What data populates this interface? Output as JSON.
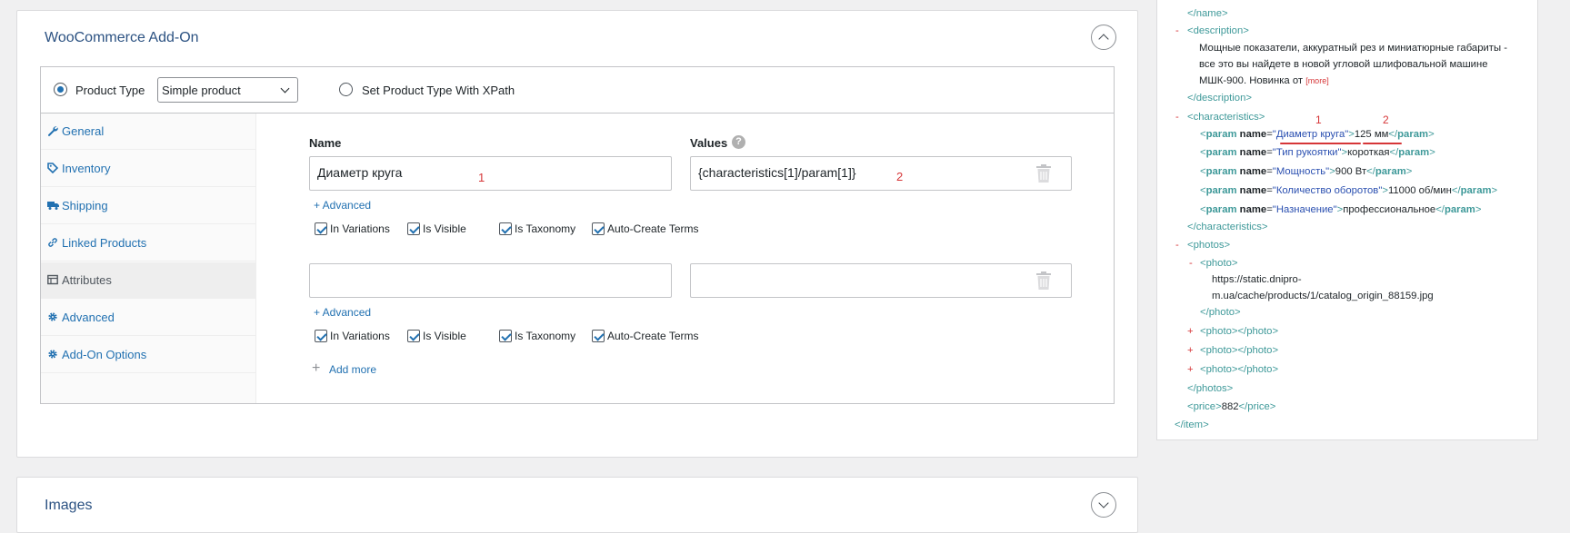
{
  "addon": {
    "title": "WooCommerce Add-On",
    "product_type_label": "Product Type",
    "product_type_value": "Simple product",
    "xpath_label": "Set Product Type With XPath"
  },
  "tabs": [
    {
      "label": "General",
      "icon": "wrench-icon"
    },
    {
      "label": "Inventory",
      "icon": "tag-icon"
    },
    {
      "label": "Shipping",
      "icon": "truck-icon"
    },
    {
      "label": "Linked Products",
      "icon": "link-icon"
    },
    {
      "label": "Attributes",
      "icon": "table-icon"
    },
    {
      "label": "Advanced",
      "icon": "gear-icon"
    },
    {
      "label": "Add-On Options",
      "icon": "gear-icon"
    }
  ],
  "attributes": {
    "name_header": "Name",
    "values_header": "Values",
    "help_glyph": "?",
    "rows": [
      {
        "name": "Диаметр круга",
        "name_marker": "1",
        "value": "{characteristics[1]/param[1]}",
        "value_marker": "2"
      },
      {
        "name": "",
        "name_marker": "",
        "value": "",
        "value_marker": ""
      }
    ],
    "advanced_link": "+ Advanced",
    "checkboxes": [
      "In Variations",
      "Is Visible",
      "Is Taxonomy",
      "Auto-Create Terms"
    ],
    "add_more_plus": "+",
    "add_more": "Add more"
  },
  "images_panel": {
    "title": "Images"
  },
  "xml": {
    "close_name": "</name>",
    "desc_toggle": "-",
    "desc_open": "<description>",
    "desc_lines": [
      "Мощные показатели, аккуратный рез и миниатюрные габариты -",
      "все это вы найдете в новой угловой шлифовальной машине",
      "МШК-900. Новинка от"
    ],
    "more": "[more]",
    "desc_close": "</description>",
    "char_toggle": "-",
    "char_open": "<characteristics>",
    "markers": [
      "1",
      "2"
    ],
    "params": [
      {
        "name": "Диаметр круга",
        "value": "125 мм"
      },
      {
        "name": "Тип рукоятки",
        "value": "короткая"
      },
      {
        "name": "Мощность",
        "value": "900 Вт"
      },
      {
        "name": "Количество оборотов",
        "value": "11000 об/мин"
      },
      {
        "name": "Назначение",
        "value": "профессиональное"
      }
    ],
    "char_close": "</characteristics>",
    "photos_toggle": "-",
    "photos_open": "<photos>",
    "photo_toggle": "-",
    "photo_open": "<photo>",
    "photo_url_1": "https://static.dnipro-",
    "photo_url_2": "m.ua/cache/products/1/catalog_origin_88159.jpg",
    "photo_close": "</photo>",
    "collapsed_photo": "<photo></photo>",
    "collapsed_toggle": "+",
    "photos_close": "</photos>",
    "price_open": "<price>",
    "price_value": "882",
    "price_close": "</price>",
    "item_close": "</item>"
  }
}
